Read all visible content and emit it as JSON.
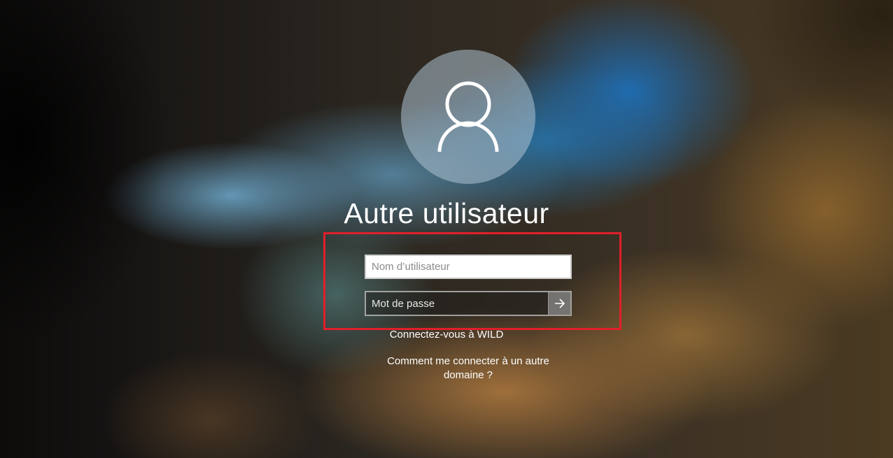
{
  "login": {
    "user_title": "Autre utilisateur",
    "username_placeholder": "Nom d’utilisateur",
    "username_value": "",
    "password_placeholder": "Mot de passe",
    "password_value": "",
    "submit_icon": "arrow-right-icon",
    "domain_text": "Connectez-vous à WILD",
    "other_domain_line1": "Comment me connecter à un autre",
    "other_domain_line2": "domaine ?"
  },
  "colors": {
    "highlight_border": "#e0202a",
    "text": "#ffffff"
  }
}
